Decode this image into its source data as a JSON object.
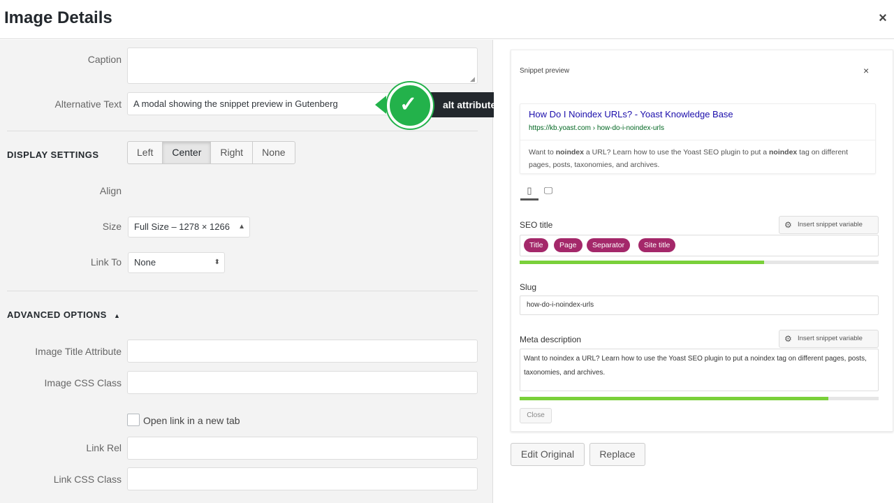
{
  "modal": {
    "title": "Image Details",
    "close_glyph": "×",
    "close_icon": "close-icon"
  },
  "left": {
    "caption_label": "Caption",
    "caption_value": "",
    "alt_label": "Alternative Text",
    "alt_value": "A modal showing the snippet preview in Gutenberg",
    "display_settings_heading": "DISPLAY SETTINGS",
    "align_label": "Align",
    "align_options": [
      "Left",
      "Center",
      "Right",
      "None"
    ],
    "align_selected": "Center",
    "size_label": "Size",
    "size_value": "Full Size – 1278 × 1266",
    "link_to_label": "Link To",
    "link_to_value": "None",
    "advanced_heading": "ADVANCED OPTIONS",
    "advanced_toggle_glyph": "▲",
    "image_title_label": "Image Title Attribute",
    "image_title_value": "",
    "image_css_label": "Image CSS Class",
    "image_css_value": "",
    "open_new_tab_label": "Open link in a new tab",
    "open_new_tab_checked": false,
    "link_rel_label": "Link Rel",
    "link_rel_value": "",
    "link_css_label": "Link CSS Class",
    "link_css_value": ""
  },
  "callout": {
    "label": "alt attribute",
    "check_glyph": "✓",
    "color": "#23b24b"
  },
  "snippet": {
    "title": "Snippet preview",
    "close_glyph": "×",
    "google_title": "How Do I Noindex URLs? - Yoast Knowledge Base",
    "google_url": "https://kb.yoast.com › how-do-i-noindex-urls",
    "google_desc_parts": [
      "Want to ",
      "noindex",
      " a URL? Learn how to use the Yoast SEO plugin to put a ",
      "noindex",
      " tag on different pages, posts, taxonomies, and archives."
    ],
    "mobile_glyph": "▯",
    "desktop_glyph": "🖵",
    "seo_title_label": "SEO title",
    "insert_var_label": "Insert snippet variable",
    "gear_glyph": "⚙",
    "pills": [
      "Title",
      "Page",
      "Separator",
      "Site title"
    ],
    "seo_title_progress": 0.68,
    "slug_label": "Slug",
    "slug_value": "how-do-i-noindex-urls",
    "meta_label": "Meta description",
    "meta_value": "Want to noindex a URL? Learn how to use the Yoast SEO plugin to put a noindex tag on different pages, posts, taxonomies, and archives.",
    "meta_progress": 0.86,
    "close_button": "Close",
    "progress_color": "#7ad03a",
    "pill_color": "#a4286a"
  },
  "actions": {
    "edit_original": "Edit Original",
    "replace": "Replace"
  }
}
